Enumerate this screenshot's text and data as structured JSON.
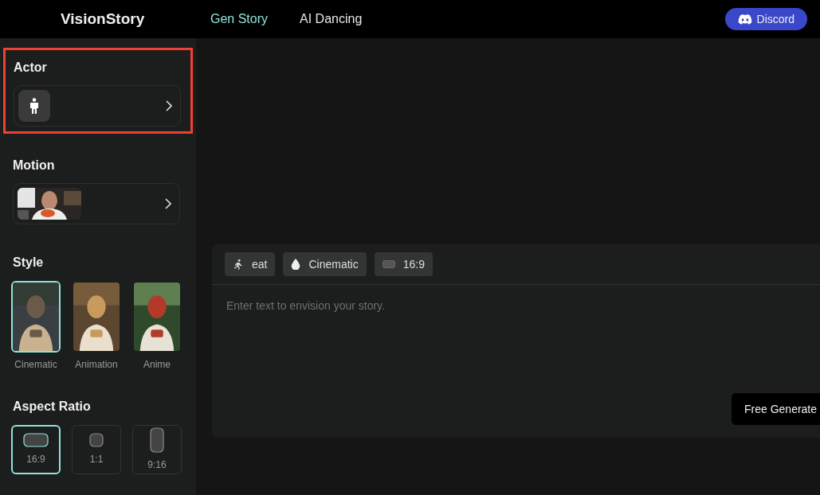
{
  "header": {
    "logo": "VisionStory",
    "nav": [
      {
        "label": "Gen Story",
        "selected": true
      },
      {
        "label": "AI Dancing",
        "selected": false
      }
    ],
    "discord_button": "Discord"
  },
  "sidebar": {
    "actor": {
      "title": "Actor",
      "highlighted": true
    },
    "motion": {
      "title": "Motion"
    },
    "style": {
      "title": "Style",
      "options": [
        {
          "label": "Cinematic",
          "selected": true
        },
        {
          "label": "Animation",
          "selected": false
        },
        {
          "label": "Anime",
          "selected": false
        }
      ]
    },
    "aspect_ratio": {
      "title": "Aspect Ratio",
      "options": [
        {
          "label": "16:9",
          "kind": "wide",
          "selected": true
        },
        {
          "label": "1:1",
          "kind": "square",
          "selected": false
        },
        {
          "label": "9:16",
          "kind": "tall",
          "selected": false
        }
      ]
    }
  },
  "composer": {
    "chips": [
      {
        "kind": "motion",
        "label": "eat"
      },
      {
        "kind": "style",
        "label": "Cinematic"
      },
      {
        "kind": "ratio",
        "label": "16:9"
      }
    ],
    "placeholder": "Enter text to envision your story.",
    "generate_button": "Free Generate"
  }
}
